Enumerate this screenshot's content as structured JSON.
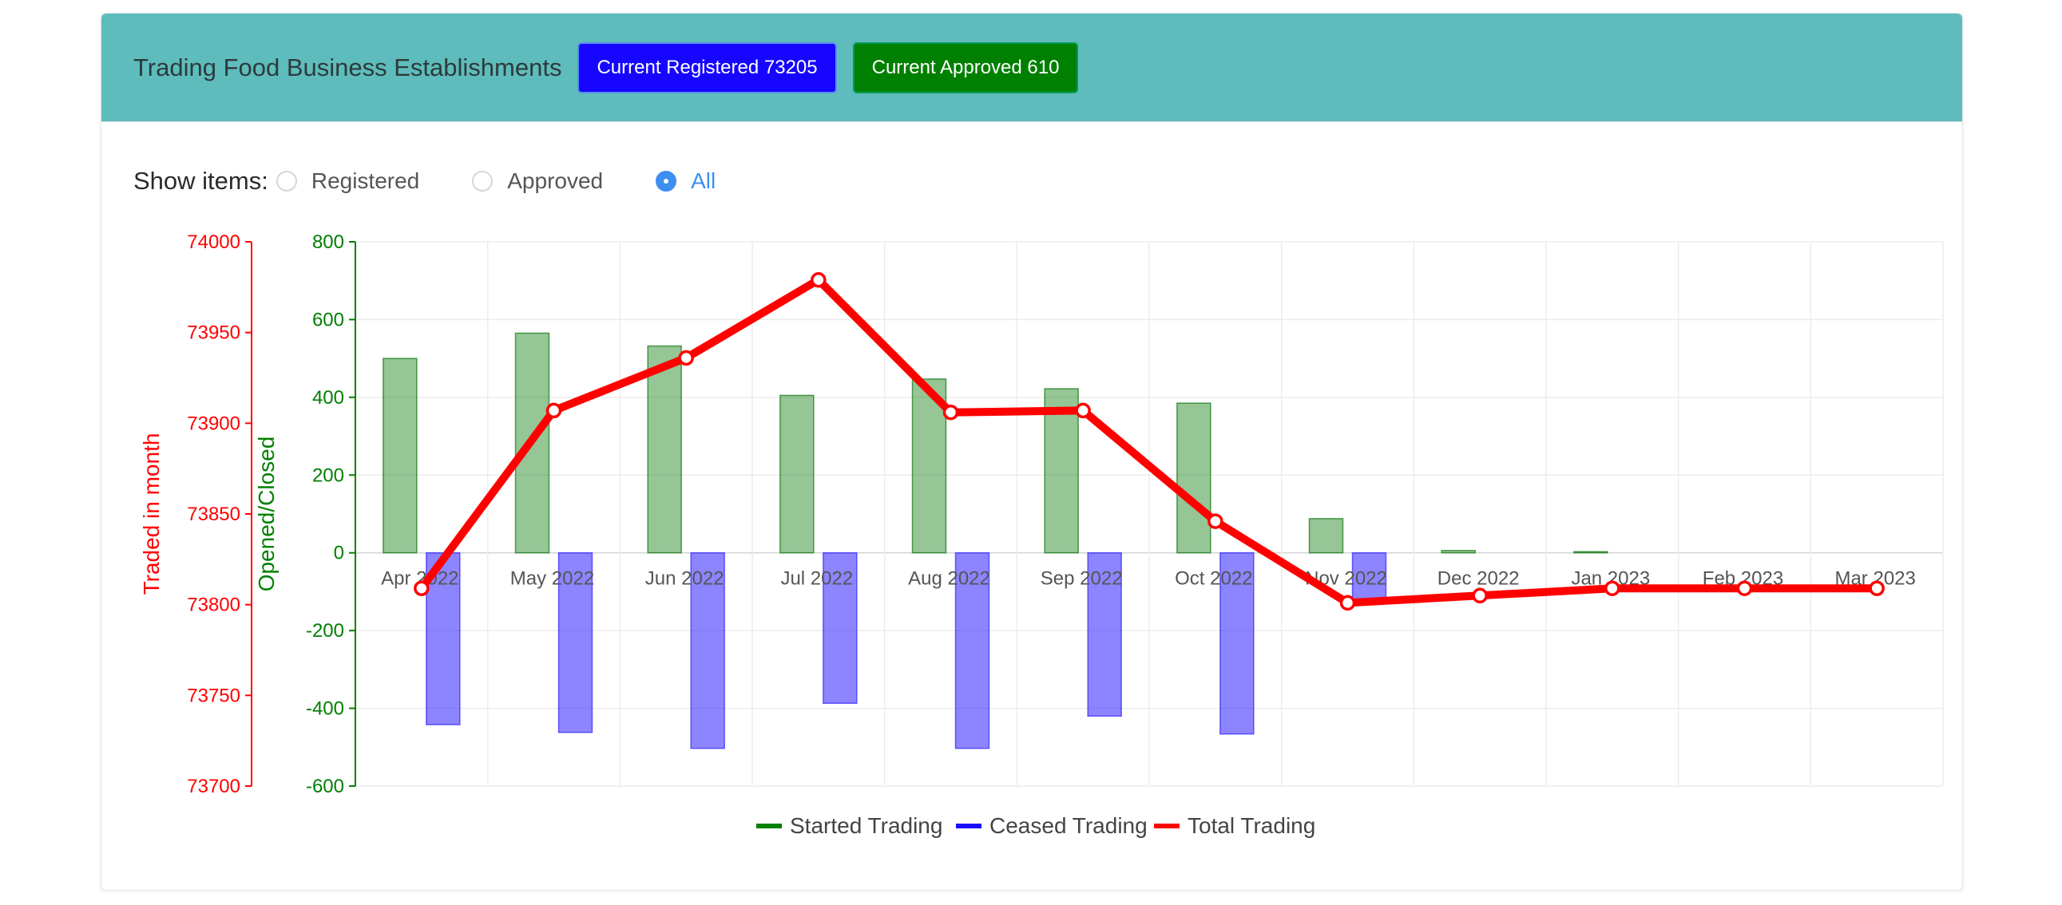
{
  "header": {
    "title": "Trading Food Business Establishments",
    "registered_badge": "Current Registered 73205",
    "approved_badge": "Current Approved 610"
  },
  "filter": {
    "label": "Show items:",
    "options": [
      "Registered",
      "Approved",
      "All"
    ],
    "selected": "All"
  },
  "colors": {
    "header_bg": "#5ebcbc",
    "registered_badge": "#1606ff",
    "approved_badge": "#008000",
    "started": "#008000",
    "ceased": "#1a0cff",
    "total": "#ff0000"
  },
  "chart_data": {
    "type": "bar",
    "categories": [
      "Apr 2022",
      "May 2022",
      "Jun 2022",
      "Jul 2022",
      "Aug 2022",
      "Sep 2022",
      "Oct 2022",
      "Nov 2022",
      "Dec 2022",
      "Jan 2023",
      "Feb 2023",
      "Mar 2023"
    ],
    "series": [
      {
        "name": "Started Trading",
        "type": "bar",
        "axis": "left-inner",
        "values": [
          500,
          565,
          532,
          405,
          447,
          422,
          385,
          88,
          6,
          3,
          0,
          0
        ]
      },
      {
        "name": "Ceased Trading",
        "type": "bar",
        "axis": "left-inner",
        "values": [
          -442,
          -462,
          -503,
          -387,
          -503,
          -420,
          -466,
          -124,
          0,
          0,
          0,
          0
        ]
      },
      {
        "name": "Total Trading",
        "type": "line",
        "axis": "left-outer",
        "values": [
          73809,
          73907,
          73936,
          73979,
          73906,
          73907,
          73846,
          73801,
          73805,
          73809,
          73809,
          73809
        ]
      }
    ],
    "y_axis_outer": {
      "label": "Traded in month",
      "ylim": [
        73700,
        74000
      ],
      "ticks": [
        73700,
        73750,
        73800,
        73850,
        73900,
        73950,
        74000
      ]
    },
    "y_axis_inner": {
      "label": "Opened/Closed",
      "ylim": [
        -600,
        800
      ],
      "ticks": [
        -600,
        -400,
        -200,
        0,
        200,
        400,
        600,
        800
      ]
    },
    "legend": [
      "Started Trading",
      "Ceased Trading",
      "Total Trading"
    ],
    "legend_position": "bottom",
    "grid": true
  }
}
